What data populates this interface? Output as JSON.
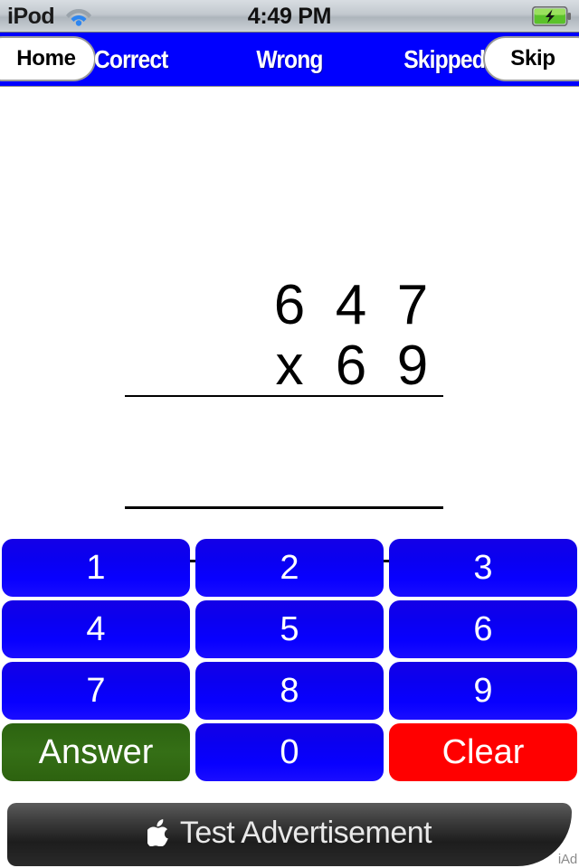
{
  "status_bar": {
    "carrier": "iPod",
    "wifi_icon": "wifi-icon",
    "time": "4:49 PM",
    "battery_icon": "battery-charging-icon"
  },
  "nav_bar": {
    "home_label": "Home",
    "skip_label": "Skip",
    "correct_label": "Correct",
    "wrong_label": "Wrong",
    "skipped_label": "Skipped",
    "background_color": "#0000ff",
    "text_color": "#ffffff"
  },
  "problem": {
    "operand_top": [
      "6",
      "4",
      "7"
    ],
    "operand_bottom": [
      "x",
      "6",
      "9"
    ],
    "operator": "x",
    "work_value": "",
    "result_value": ""
  },
  "keypad": {
    "rows": [
      [
        {
          "label": "1",
          "style": "blue",
          "name": "key-1"
        },
        {
          "label": "2",
          "style": "blue",
          "name": "key-2"
        },
        {
          "label": "3",
          "style": "blue",
          "name": "key-3"
        }
      ],
      [
        {
          "label": "4",
          "style": "blue",
          "name": "key-4"
        },
        {
          "label": "5",
          "style": "blue",
          "name": "key-5"
        },
        {
          "label": "6",
          "style": "blue",
          "name": "key-6"
        }
      ],
      [
        {
          "label": "7",
          "style": "blue",
          "name": "key-7"
        },
        {
          "label": "8",
          "style": "blue",
          "name": "key-8"
        },
        {
          "label": "9",
          "style": "blue",
          "name": "key-9"
        }
      ],
      [
        {
          "label": "Answer",
          "style": "green",
          "name": "key-answer"
        },
        {
          "label": "0",
          "style": "blue",
          "name": "key-0"
        },
        {
          "label": "Clear",
          "style": "red",
          "name": "key-clear"
        }
      ]
    ],
    "blue_color": "#0800ff",
    "green_color": "#2c6310",
    "red_color": "#ff0000"
  },
  "ad": {
    "logo_icon": "apple-logo-icon",
    "text": "Test Advertisement",
    "network_label": "iAd"
  }
}
